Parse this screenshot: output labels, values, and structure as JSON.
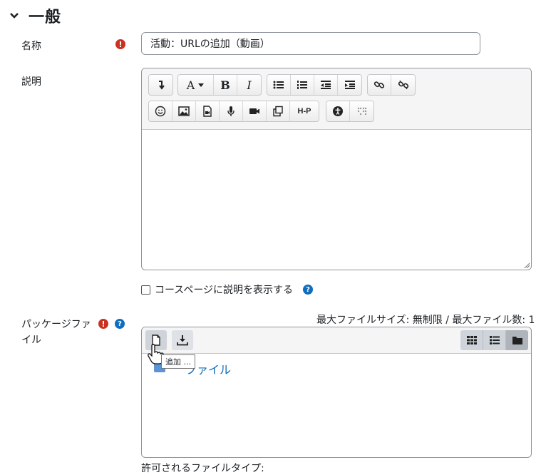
{
  "section": {
    "title": "一般"
  },
  "name_field": {
    "label": "名称",
    "value": "活動：URLの追加（動画）"
  },
  "description_field": {
    "label": "説明"
  },
  "editor_toolbar": {
    "row1": [
      "collapse-icon",
      "font-style-icon",
      "bold-icon",
      "italic-icon",
      "bullet-list-icon",
      "numbered-list-icon",
      "outdent-icon",
      "indent-icon",
      "link-icon",
      "unlink-icon"
    ],
    "row2": [
      "emoji-icon",
      "image-icon",
      "media-icon",
      "microphone-icon",
      "video-icon",
      "copy-icon",
      "h5p-icon",
      "accessibility-checker-icon",
      "screenreader-helper-icon"
    ],
    "font_glyph": "A",
    "bold_glyph": "B",
    "italic_glyph": "I",
    "h5p_label": "H-P"
  },
  "show_description": {
    "label": "コースページに説明を表示する",
    "checked": false
  },
  "package_field": {
    "label_line1": "パッケージファ",
    "label_line2": "イル"
  },
  "file_picker": {
    "max_info": "最大ファイルサイズ: 無制限 / 最大ファイル数: 1",
    "tooltip": "追加 ...",
    "files_link": "ファイル"
  },
  "allowed_types_label": "許可されるファイルタイプ:",
  "colors": {
    "required": "#ca3120",
    "help": "#0f6cbf",
    "link": "#0f6cbf"
  }
}
